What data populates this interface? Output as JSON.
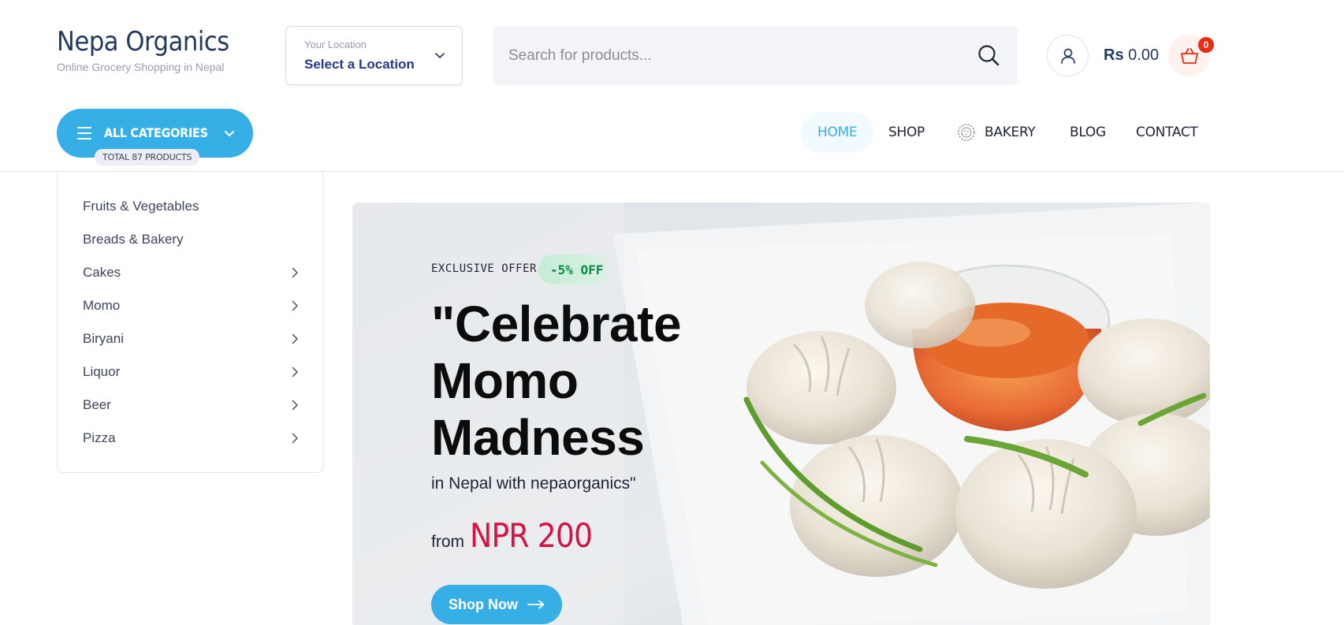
{
  "brand": {
    "title": "Nepa Organics",
    "subtitle": "Online Grocery Shopping in Nepal"
  },
  "location": {
    "label": "Your Location",
    "value": "Select a Location",
    "icon": "chevron-down-icon"
  },
  "search": {
    "placeholder": "Search for products...",
    "icon": "search-icon"
  },
  "account": {
    "icon": "user-icon"
  },
  "cart": {
    "currency": "Rs",
    "amount": "0.00",
    "count": "0",
    "icon": "shopping-basket-icon",
    "badge_color": "#ea2b0f"
  },
  "categories_button": {
    "label": "ALL CATEGORIES",
    "total": "TOTAL 87 PRODUCTS",
    "color": "#35afe6"
  },
  "nav": {
    "items": [
      {
        "label": "HOME",
        "active": true
      },
      {
        "label": "SHOP"
      },
      {
        "label": "BAKERY",
        "icon": "bakery-icon"
      },
      {
        "label": "BLOG"
      },
      {
        "label": "CONTACT"
      }
    ]
  },
  "sidebar": {
    "items": [
      {
        "label": "Fruits & Vegetables",
        "has_submenu": false
      },
      {
        "label": "Breads & Bakery",
        "has_submenu": false
      },
      {
        "label": "Cakes",
        "has_submenu": true
      },
      {
        "label": "Momo",
        "has_submenu": true
      },
      {
        "label": "Biryani",
        "has_submenu": true
      },
      {
        "label": "Liquor",
        "has_submenu": true
      },
      {
        "label": "Beer",
        "has_submenu": true
      },
      {
        "label": "Pizza",
        "has_submenu": true
      }
    ]
  },
  "hero": {
    "offer_label": "EXCLUSIVE OFFER",
    "offer_badge": "-5% OFF",
    "title_lines": [
      "\"Celebrate",
      "Momo",
      "Madness"
    ],
    "subtitle": "in Nepal with nepaorganics\"",
    "price_prefix": "from",
    "price": "NPR 200",
    "cta": "Shop Now",
    "price_color": "#d51243"
  }
}
